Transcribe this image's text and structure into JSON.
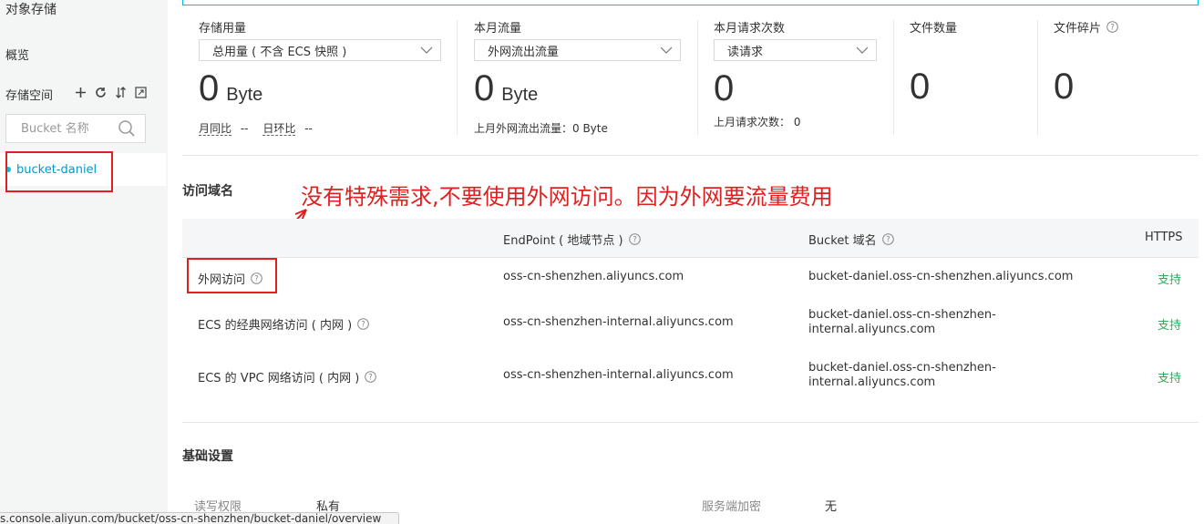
{
  "sidebar": {
    "title": "对象存储",
    "overview": "概览",
    "bucket_space": "存储空间",
    "search_placeholder": "Bucket 名称",
    "bucket_name": "bucket-daniel"
  },
  "stats": {
    "storage": {
      "label": "存储用量",
      "select": "总用量 ( 不含 ECS 快照 )",
      "value": "0",
      "unit": "Byte",
      "mom_label": "月同比",
      "mom_value": "--",
      "dod_label": "日环比",
      "dod_value": "--"
    },
    "traffic": {
      "label": "本月流量",
      "select": "外网流出流量",
      "value": "0",
      "unit": "Byte",
      "sub": "上月外网流出流量：0 Byte"
    },
    "requests": {
      "label": "本月请求次数",
      "select": "读请求",
      "value": "0",
      "sub": "上月请求次数：  0"
    },
    "files": {
      "label": "文件数量",
      "value": "0"
    },
    "fragments": {
      "label": "文件碎片",
      "value": "0"
    }
  },
  "access": {
    "title": "访问域名",
    "annotation": "没有特殊需求,不要使用外网访问。因为外网要流量费用",
    "headers": {
      "endpoint": "EndPoint ( 地域节点 )",
      "bucket_domain": "Bucket 域名",
      "https": "HTTPS"
    },
    "rows": [
      {
        "type": "外网访问",
        "endpoint": "oss-cn-shenzhen.aliyuncs.com",
        "domain_line1": "bucket-daniel.oss-cn-shenzhen.aliyuncs.com",
        "domain_line2": "",
        "https": "支持"
      },
      {
        "type": "ECS 的经典网络访问 ( 内网 )",
        "endpoint": "oss-cn-shenzhen-internal.aliyuncs.com",
        "domain_line1": "bucket-daniel.oss-cn-shenzhen-",
        "domain_line2": "internal.aliyuncs.com",
        "https": "支持"
      },
      {
        "type": "ECS 的 VPC 网络访问 ( 内网 )",
        "endpoint": "oss-cn-shenzhen-internal.aliyuncs.com",
        "domain_line1": "bucket-daniel.oss-cn-shenzhen-",
        "domain_line2": "internal.aliyuncs.com",
        "https": "支持"
      }
    ]
  },
  "basic": {
    "title": "基础设置",
    "rw_label": "读写权限",
    "rw_value": "私有",
    "enc_label": "服务端加密",
    "enc_value": "无"
  },
  "status_bar": "s.console.aliyun.com/bucket/oss-cn-shenzhen/bucket-daniel/overview",
  "colors": {
    "accent": "#00c1de",
    "link": "#0099cc",
    "success": "#2eac59",
    "annotation": "#e02020"
  }
}
